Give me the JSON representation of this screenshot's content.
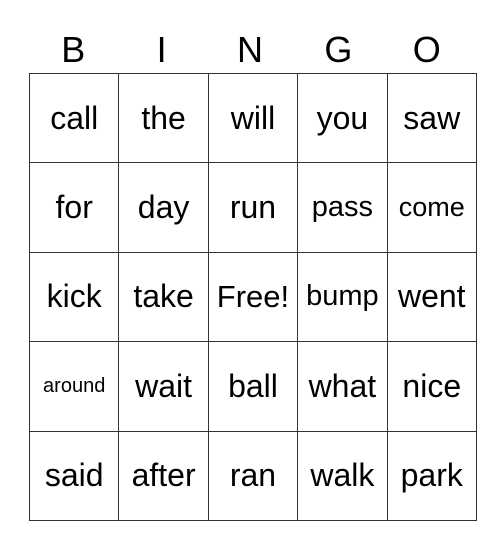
{
  "header": [
    "B",
    "I",
    "N",
    "G",
    "O"
  ],
  "rows": [
    [
      "call",
      "the",
      "will",
      "you",
      "saw"
    ],
    [
      "for",
      "day",
      "run",
      "pass",
      "come"
    ],
    [
      "kick",
      "take",
      "Free!",
      "bump",
      "went"
    ],
    [
      "around",
      "wait",
      "ball",
      "what",
      "nice"
    ],
    [
      "said",
      "after",
      "ran",
      "walk",
      "park"
    ]
  ]
}
